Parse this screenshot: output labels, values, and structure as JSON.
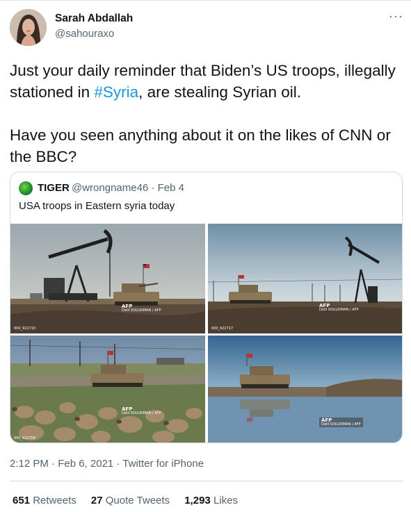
{
  "author": {
    "name": "Sarah Abdallah",
    "handle": "@sahouraxo"
  },
  "more_label": "···",
  "tweet": {
    "text_before": "Just your daily reminder that Biden’s US troops, illegally stationed in ",
    "hashtag": "#Syria",
    "text_after": ", are stealing Syrian oil.",
    "paragraph2": "Have you seen anything about it on the likes of CNN or the BBC?"
  },
  "quote": {
    "name": "TIGER",
    "handle": "@wrongname46 · Feb 4",
    "text": "USA troops in Eastern syria today",
    "photos": [
      {
        "agency": "AFP",
        "credit": "Delil SOULEIMAN / AFP",
        "code": "000_922710"
      },
      {
        "agency": "AFP",
        "credit": "Delil SOULEIMAN / AFP",
        "code": "000_922717"
      },
      {
        "agency": "AFP",
        "credit": "Delil SOULEIMAN / AFP",
        "code": "000_922708"
      },
      {
        "agency": "AFP",
        "credit": "Delil SOULEIMAN / AFP",
        "code": ""
      }
    ]
  },
  "meta": "2:12 PM · Feb 6, 2021 · Twitter for iPhone",
  "stats": {
    "retweets_count": "651",
    "retweets_label": "Retweets",
    "quotes_count": "27",
    "quotes_label": "Quote Tweets",
    "likes_count": "1,293",
    "likes_label": "Likes"
  },
  "colors": {
    "hashtag": "#1b95e0",
    "secondary_text": "#536471",
    "border": "#cfd9de"
  }
}
